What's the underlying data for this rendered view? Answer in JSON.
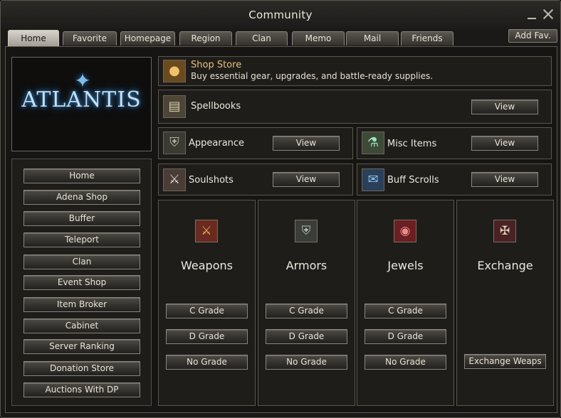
{
  "window": {
    "title": "Community"
  },
  "tabs": [
    {
      "label": "Home",
      "active": true
    },
    {
      "label": "Favorite"
    },
    {
      "label": "Homepage"
    },
    {
      "label": "Region"
    },
    {
      "label": "Clan"
    },
    {
      "label": "Memo"
    },
    {
      "label": "Mail"
    },
    {
      "label": "Friends"
    }
  ],
  "add_fav_label": "Add Fav.",
  "logo_text": "ATLANTIS",
  "sidebar": {
    "items": [
      {
        "label": "Home"
      },
      {
        "label": "Adena Shop"
      },
      {
        "label": "Buffer"
      },
      {
        "label": "Teleport"
      },
      {
        "label": "Clan"
      },
      {
        "label": "Event Shop"
      },
      {
        "label": "Item Broker"
      },
      {
        "label": "Cabinet"
      },
      {
        "label": "Server Ranking"
      },
      {
        "label": "Donation Store"
      },
      {
        "label": "Auctions With DP"
      }
    ]
  },
  "shop": {
    "title": "Shop Store",
    "subtitle": "Buy essential gear, upgrades, and battle-ready supplies.",
    "icon": "coin-bag-icon"
  },
  "rows": {
    "spellbooks": {
      "label": "Spellbooks",
      "button": "View",
      "icon": "spellbook-icon"
    },
    "appearance": {
      "label": "Appearance",
      "button": "View",
      "icon": "armor-appearance-icon"
    },
    "misc": {
      "label": "Misc Items",
      "button": "View",
      "icon": "potion-icon"
    },
    "soulshots": {
      "label": "Soulshots",
      "button": "View",
      "icon": "soulshot-icon"
    },
    "buff_scrolls": {
      "label": "Buff Scrolls",
      "button": "View",
      "icon": "scroll-icon"
    }
  },
  "categories": [
    {
      "title": "Weapons",
      "icon": "weapon-icon",
      "buttons": [
        "C Grade",
        "D Grade",
        "No Grade"
      ]
    },
    {
      "title": "Armors",
      "icon": "armor-icon",
      "buttons": [
        "C Grade",
        "D Grade",
        "No Grade"
      ]
    },
    {
      "title": "Jewels",
      "icon": "jewel-icon",
      "buttons": [
        "C Grade",
        "D Grade",
        "No Grade"
      ]
    },
    {
      "title": "Exchange",
      "icon": "exchange-icon",
      "buttons": [
        "Exchange Weaps"
      ]
    }
  ],
  "colors": {
    "accent_gold": "#e5c17a",
    "frame": "#5a564e",
    "button_border": "#8b867c"
  }
}
